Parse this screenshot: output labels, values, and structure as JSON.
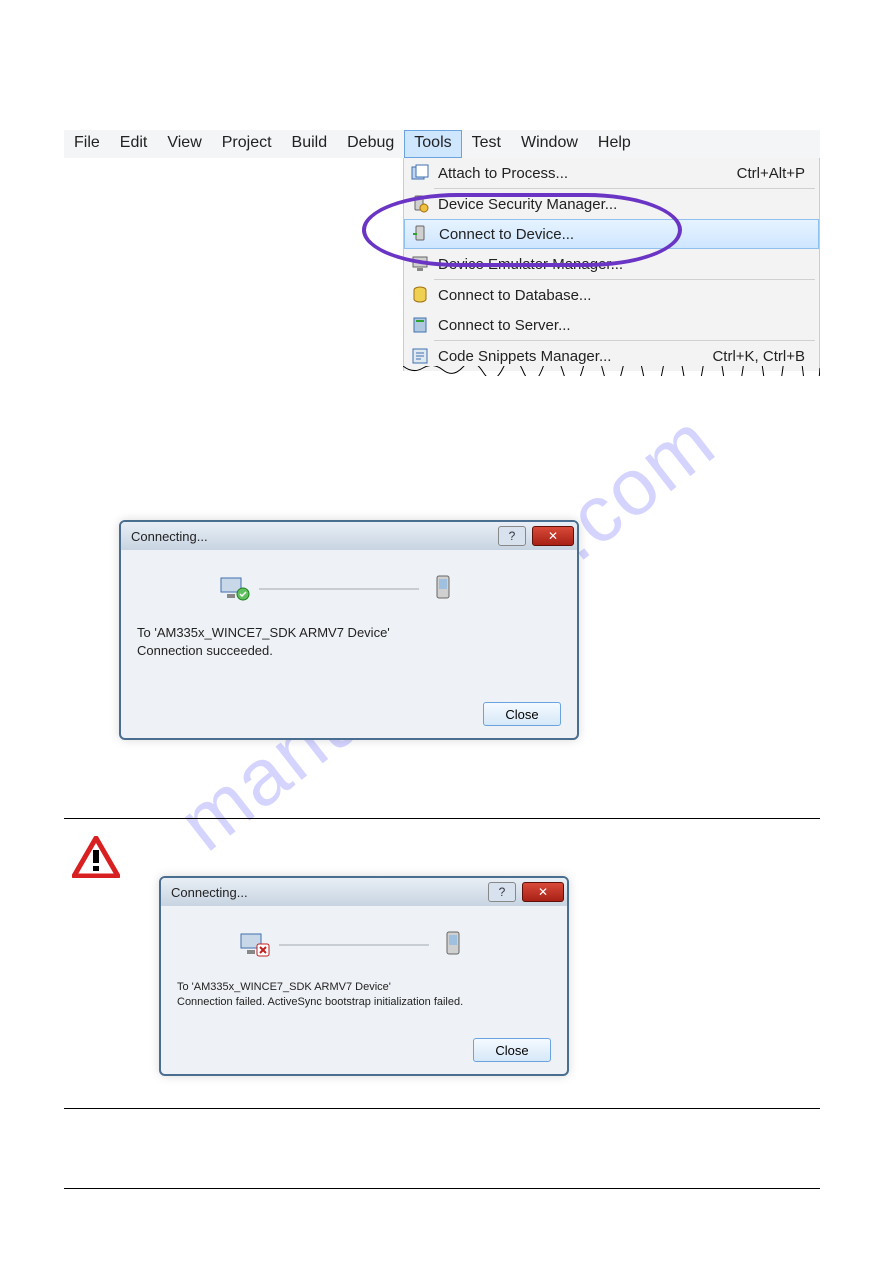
{
  "menubar": {
    "items": [
      "File",
      "Edit",
      "View",
      "Project",
      "Build",
      "Debug",
      "Tools",
      "Test",
      "Window",
      "Help"
    ],
    "active_index": 6
  },
  "dropdown": {
    "groups": [
      [
        {
          "label": "Attach to Process...",
          "shortcut": "Ctrl+Alt+P",
          "icon": "attach-process-icon"
        }
      ],
      [
        {
          "label": "Device Security Manager...",
          "icon": "device-security-icon"
        },
        {
          "label": "Connect to Device...",
          "icon": "connect-device-icon",
          "highlighted": true
        },
        {
          "label": "Device Emulator Manager...",
          "icon": "device-emulator-icon"
        }
      ],
      [
        {
          "label": "Connect to Database...",
          "icon": "connect-database-icon"
        },
        {
          "label": "Connect to Server...",
          "icon": "connect-server-icon"
        }
      ],
      [
        {
          "label": "Code Snippets Manager...",
          "shortcut": "Ctrl+K, Ctrl+B",
          "icon": "code-snippets-icon"
        }
      ]
    ]
  },
  "dialog1": {
    "title": "Connecting...",
    "line1": "To 'AM335x_WINCE7_SDK ARMV7 Device'",
    "line2": "Connection succeeded.",
    "close": "Close",
    "help": "?",
    "x": "✕"
  },
  "dialog2": {
    "title": "Connecting...",
    "line1": "To 'AM335x_WINCE7_SDK ARMV7 Device'",
    "line2": "Connection failed. ActiveSync bootstrap initialization failed.",
    "close": "Close",
    "help": "?",
    "x": "✕"
  },
  "watermark": "manualshive.com"
}
